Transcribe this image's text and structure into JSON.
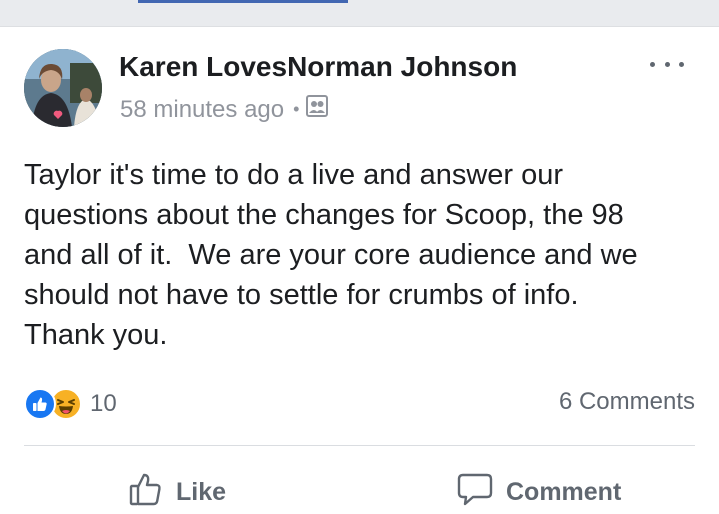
{
  "post": {
    "author": "Karen LovesNorman Johnson",
    "timestamp": "58 minutes ago",
    "separator": "•",
    "privacy_icon": "group-privacy-icon",
    "more_icon": "more-options-icon",
    "text": "Taylor it's time to do a live and answer our\nquestions about the changes for Scoop, the 98\nand all of it.  We are your core audience and we\nshould not have to settle for crumbs of info.\nThank you."
  },
  "reactions": {
    "types": [
      "like",
      "haha"
    ],
    "count": "10"
  },
  "comments": {
    "count_label": "6 Comments"
  },
  "actions": {
    "like_label": "Like",
    "comment_label": "Comment"
  },
  "colors": {
    "like_blue": "#1877f2",
    "haha_yellow": "#f7b125",
    "secondary_text": "#90949c",
    "action_gray": "#606770"
  }
}
